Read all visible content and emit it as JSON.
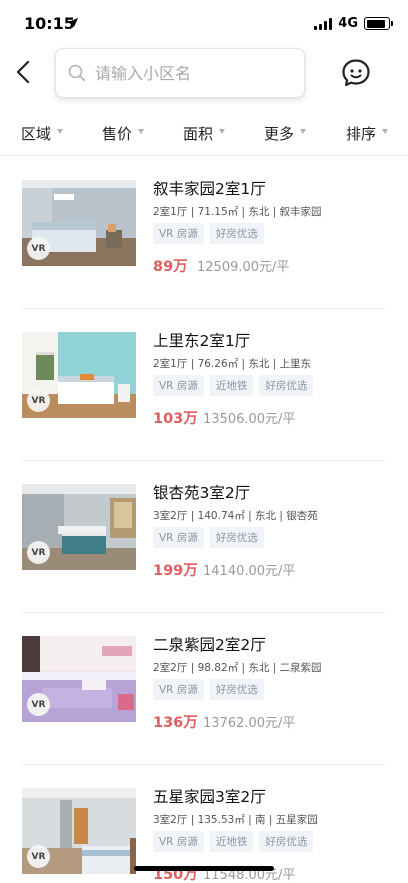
{
  "status_bar": {
    "time": "10:15",
    "network": "4G",
    "battery_level": 0.9
  },
  "header": {
    "back_icon": "chevron-left-icon",
    "search_icon": "search-icon",
    "search_placeholder": "请输入小区名",
    "message_icon": "chat-bubble-icon"
  },
  "filters": [
    {
      "label": "区域"
    },
    {
      "label": "售价"
    },
    {
      "label": "面积"
    },
    {
      "label": "更多"
    },
    {
      "label": "排序"
    }
  ],
  "listings": [
    {
      "title": "叙丰家园2室1厅",
      "meta": "2室1厅 | 71.15㎡ | 东北 | 叙丰家园",
      "tags": [
        "VR 房源",
        "好房优选"
      ],
      "price": "89万",
      "unit_price": "12509.00元/平",
      "vr_badge": "VR"
    },
    {
      "title": "上里东2室1厅",
      "meta": "2室1厅 | 76.26㎡ | 东北 | 上里东",
      "tags": [
        "VR 房源",
        "近地铁",
        "好房优选"
      ],
      "price": "103万",
      "unit_price": "13506.00元/平",
      "vr_badge": "VR"
    },
    {
      "title": "银杏苑3室2厅",
      "meta": "3室2厅 | 140.74㎡ | 东北 | 银杏苑",
      "tags": [
        "VR 房源",
        "好房优选"
      ],
      "price": "199万",
      "unit_price": "14140.00元/平",
      "vr_badge": "VR"
    },
    {
      "title": "二泉紫园2室2厅",
      "meta": "2室2厅 | 98.82㎡ | 东北 | 二泉紫园",
      "tags": [
        "VR 房源",
        "好房优选"
      ],
      "price": "136万",
      "unit_price": "13762.00元/平",
      "vr_badge": "VR"
    },
    {
      "title": "五星家园3室2厅",
      "meta": "3室2厅 | 135.53㎡ | 南 | 五星家园",
      "tags": [
        "VR 房源",
        "近地铁",
        "好房优选"
      ],
      "price": "150万",
      "unit_price": "11548.00元/平",
      "vr_badge": "VR"
    }
  ],
  "colors": {
    "price": "#e05e5e",
    "tag_bg": "#f0f3f8",
    "tag_text": "#8c96a5"
  }
}
